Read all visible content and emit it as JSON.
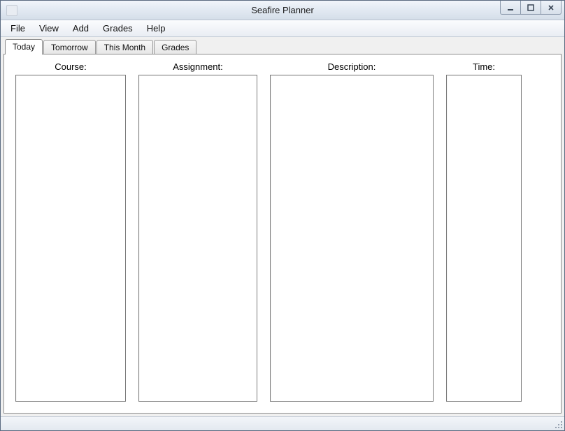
{
  "window": {
    "title": "Seafire Planner"
  },
  "menubar": {
    "items": [
      "File",
      "View",
      "Add",
      "Grades",
      "Help"
    ]
  },
  "tabs": {
    "items": [
      "Today",
      "Tomorrow",
      "This Month",
      "Grades"
    ],
    "active_index": 0
  },
  "columns": {
    "course": {
      "label": "Course:"
    },
    "assignment": {
      "label": "Assignment:"
    },
    "description": {
      "label": "Description:"
    },
    "time": {
      "label": "Time:"
    }
  }
}
